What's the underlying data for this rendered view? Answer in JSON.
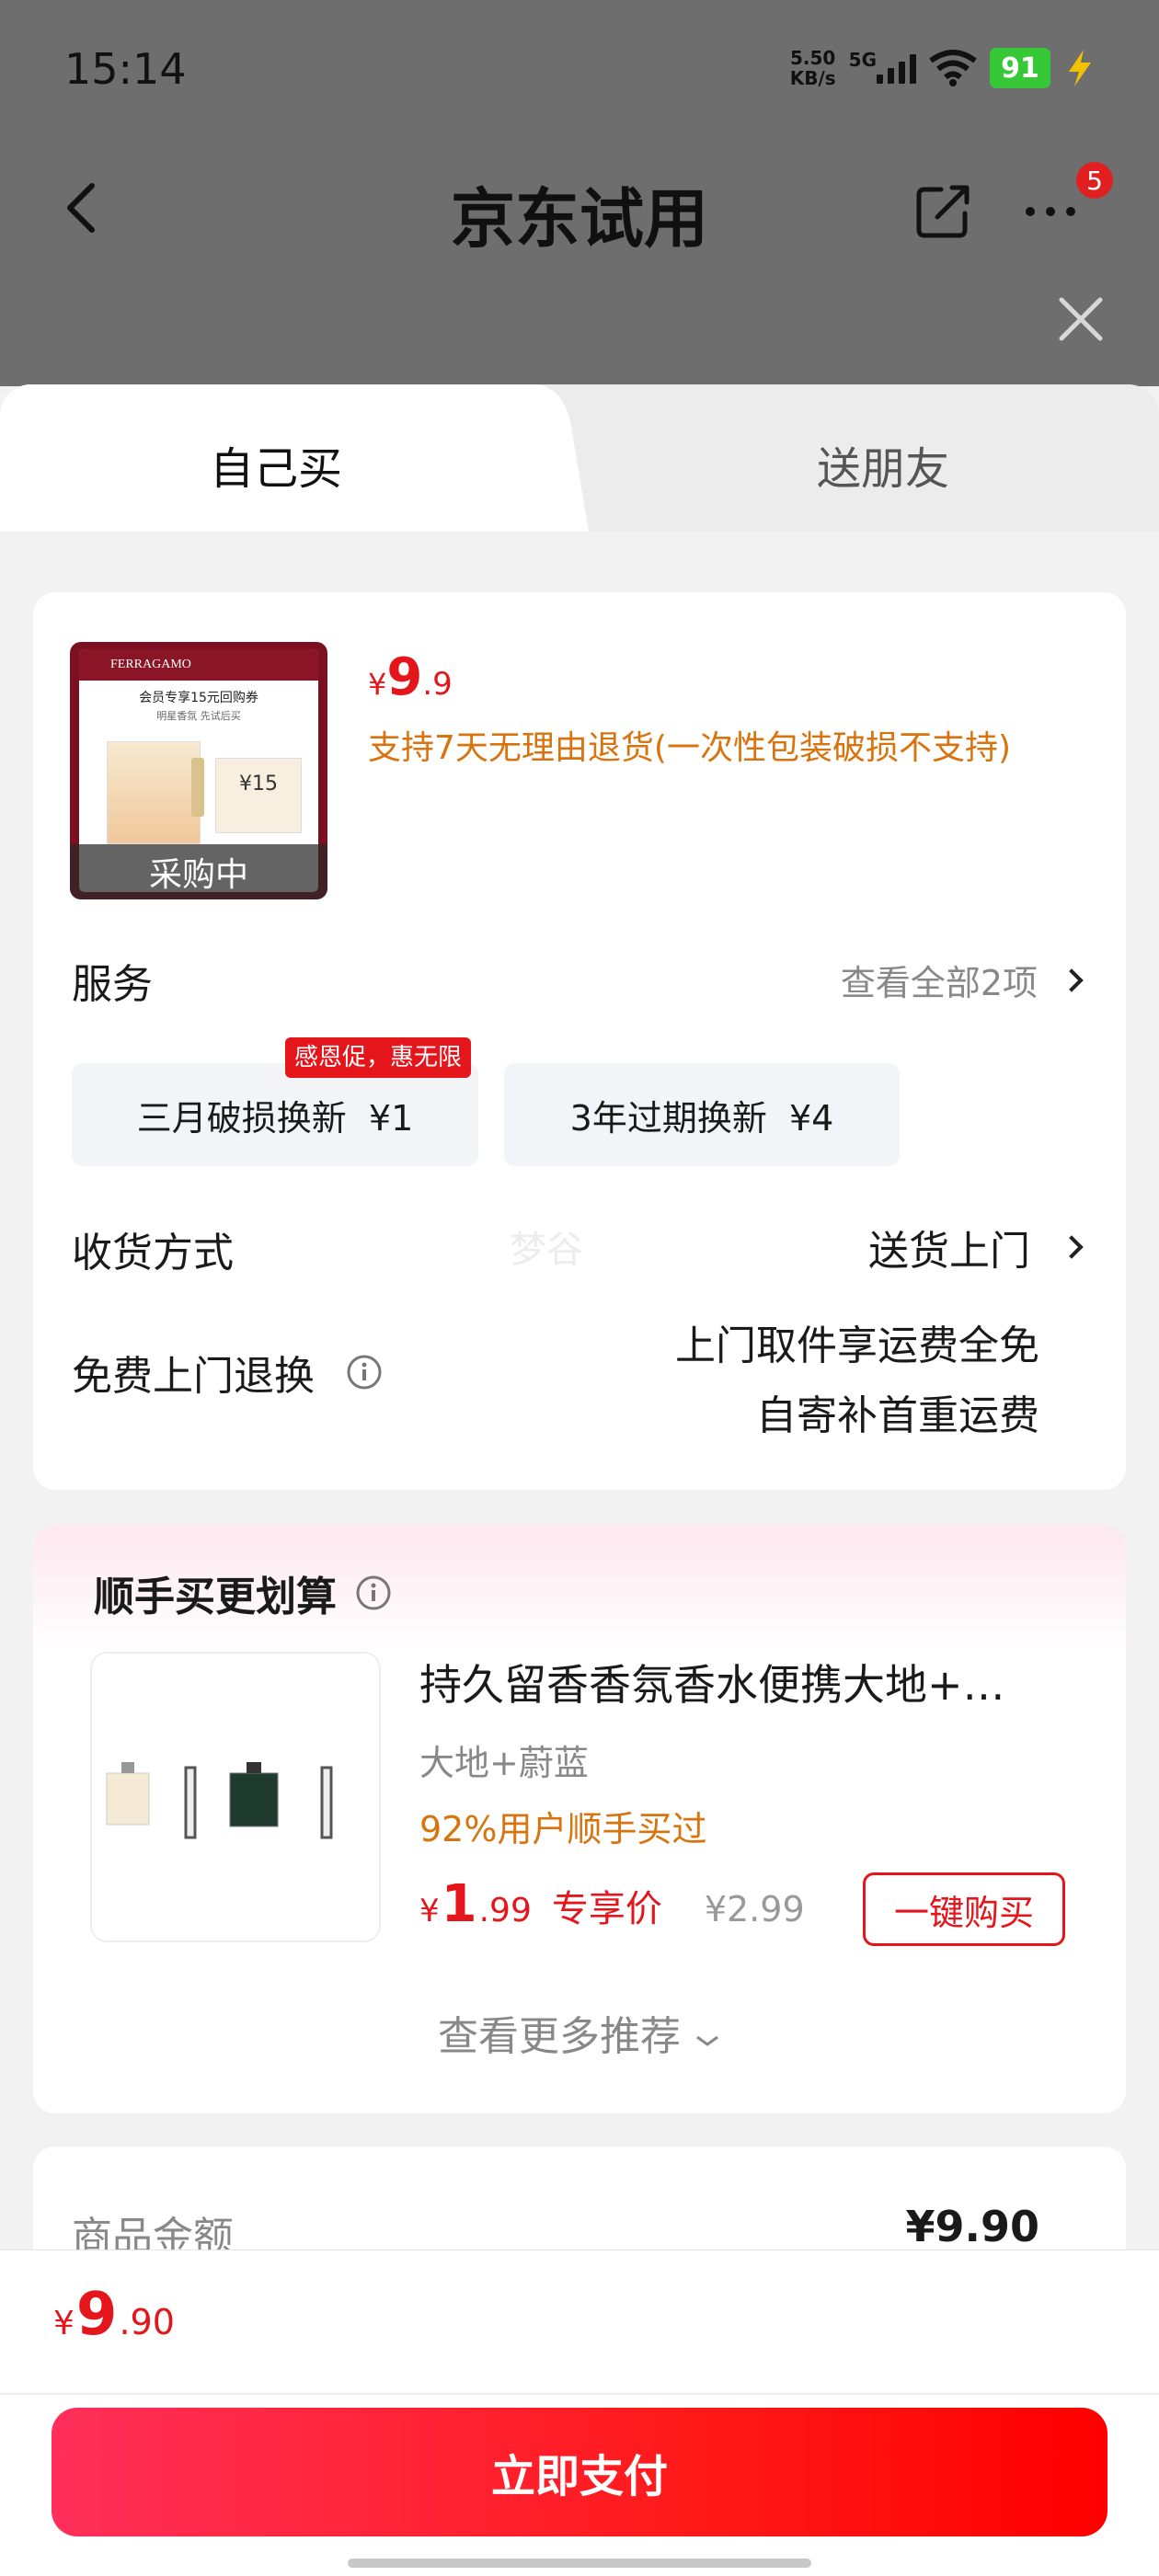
{
  "status_bar": {
    "time": "15:14",
    "net_speed_value": "5.50",
    "net_speed_unit": "KB/s",
    "network": "5G",
    "battery": "91"
  },
  "nav": {
    "title": "京东试用",
    "badge": "5"
  },
  "tabs": [
    {
      "label": "自己买",
      "active": true
    },
    {
      "label": "送朋友",
      "active": false
    }
  ],
  "product": {
    "image_header": "FERRAGAMO",
    "image_coupon_title": "会员专享15元回购券",
    "image_coupon_sub": "明星香氛 先试后买",
    "image_coupon_amount": "¥15",
    "overlay": "采购中",
    "price_symbol": "¥",
    "price_int": "9",
    "price_dec": ".9",
    "return_policy": "支持7天无理由退货(一次性包装破损不支持)"
  },
  "service": {
    "label": "服务",
    "view_all": "查看全部2项",
    "chips": [
      {
        "text": "三月破损换新  ¥1",
        "tag": "感恩促，惠无限"
      },
      {
        "text": "3年过期换新  ¥4"
      }
    ]
  },
  "delivery": {
    "label": "收货方式",
    "watermark": "梦谷",
    "value": "送货上门"
  },
  "free_return": {
    "label": "免费上门退换",
    "line1": "上门取件享运费全免",
    "line2": "自寄补首重运费"
  },
  "addon": {
    "title": "顺手买更划算",
    "item_title": "持久留香香氛香水便携大地+…",
    "item_variant": "大地+蔚蓝",
    "item_stat": "92%用户顺手买过",
    "price_symbol": "¥",
    "price_int": "1",
    "price_dec": ".99",
    "price_label": "专享价",
    "orig_price": "¥2.99",
    "buy_button": "一键购买",
    "more": "查看更多推荐"
  },
  "summary": {
    "label": "商品金额",
    "value": "¥9.90"
  },
  "bottom": {
    "price_symbol": "¥",
    "price_int": "9",
    "price_dec": ".90",
    "pay_button": "立即支付"
  },
  "colors": {
    "accent_red": "#e4151b",
    "orange_text": "#d9730d",
    "pay_gradient_start": "#ff2f5a",
    "pay_gradient_end": "#ff0000"
  }
}
